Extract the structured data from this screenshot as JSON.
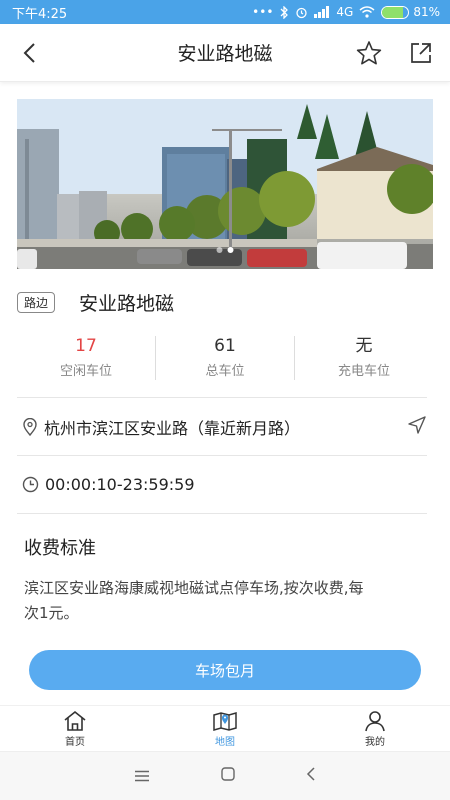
{
  "status": {
    "time": "下午4:25",
    "network": "4G",
    "battery_text": "81%",
    "battery_level": 0.81
  },
  "header": {
    "title": "安业路地磁",
    "back_icon": "back-arrow-icon",
    "favorite_icon": "star-icon",
    "share_icon": "share-icon"
  },
  "photo": {
    "slide_count": 2,
    "active_slide": 1
  },
  "lot": {
    "tag": "路边",
    "name": "安业路地磁"
  },
  "stats": [
    {
      "value": "17",
      "label": "空闲车位",
      "color": "#e34545"
    },
    {
      "value": "61",
      "label": "总车位"
    },
    {
      "value": "无",
      "label": "充电车位"
    }
  ],
  "address": {
    "text": "杭州市滨江区安业路（靠近新月路）",
    "icon": "location-pin-icon",
    "nav_icon": "navigate-icon"
  },
  "hours": {
    "text": "00:00:10-23:59:59",
    "icon": "clock-icon"
  },
  "fee": {
    "title": "收费标准",
    "text": "滨江区安业路海康威视地磁试点停车场,按次收费,每次1元。"
  },
  "primary_button": {
    "label": "车场包月",
    "color": "#59abf0"
  },
  "tabs": [
    {
      "label": "首页",
      "icon": "home-icon"
    },
    {
      "label": "地图",
      "icon": "map-icon",
      "active": true
    },
    {
      "label": "我的",
      "icon": "user-icon"
    }
  ],
  "colors": {
    "accent": "#3f96df",
    "status_bar": "#4aa3e8"
  }
}
